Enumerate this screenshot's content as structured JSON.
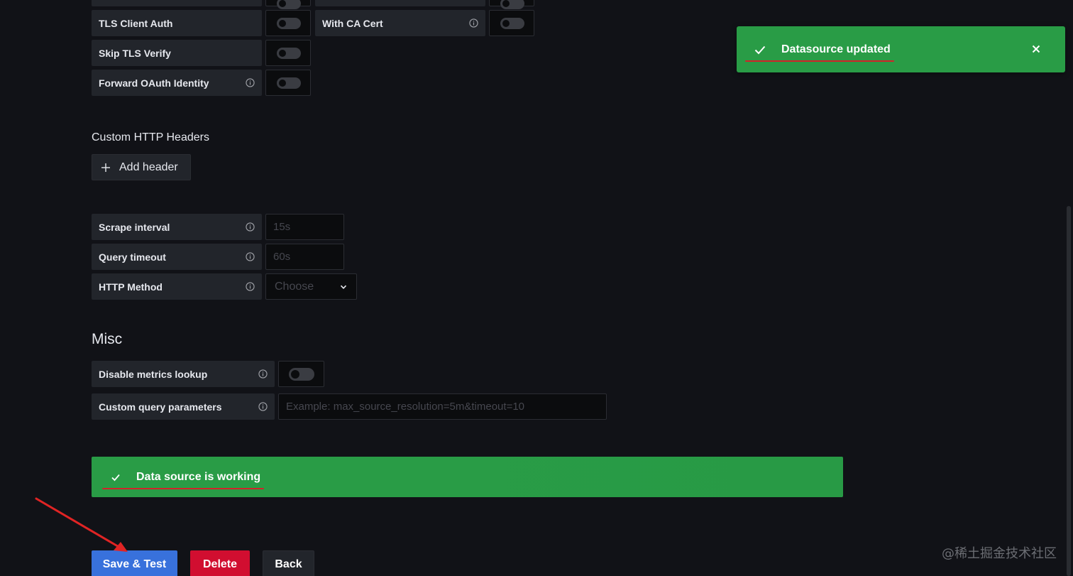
{
  "auth": {
    "tls_client_auth_label": "TLS Client Auth",
    "with_ca_cert_label": "With CA Cert",
    "skip_tls_verify_label": "Skip TLS Verify",
    "forward_oauth_label": "Forward OAuth Identity"
  },
  "headers": {
    "title": "Custom HTTP Headers",
    "add_button_label": "Add header"
  },
  "prometheus": {
    "scrape_interval_label": "Scrape interval",
    "scrape_interval_placeholder": "15s",
    "query_timeout_label": "Query timeout",
    "query_timeout_placeholder": "60s",
    "http_method_label": "HTTP Method",
    "http_method_value": "Choose"
  },
  "misc": {
    "title": "Misc",
    "disable_metrics_label": "Disable metrics lookup",
    "custom_query_label": "Custom query parameters",
    "custom_query_placeholder": "Example: max_source_resolution=5m&timeout=10"
  },
  "status": {
    "message": "Data source is working"
  },
  "toast": {
    "message": "Datasource updated"
  },
  "actions": {
    "save_label": "Save & Test",
    "delete_label": "Delete",
    "back_label": "Back"
  },
  "watermark": "@稀土掘金技术社区",
  "colors": {
    "background": "#111217",
    "success": "#299c46",
    "primary": "#3871dc",
    "danger": "#d10e30",
    "secondary": "#22252b"
  }
}
